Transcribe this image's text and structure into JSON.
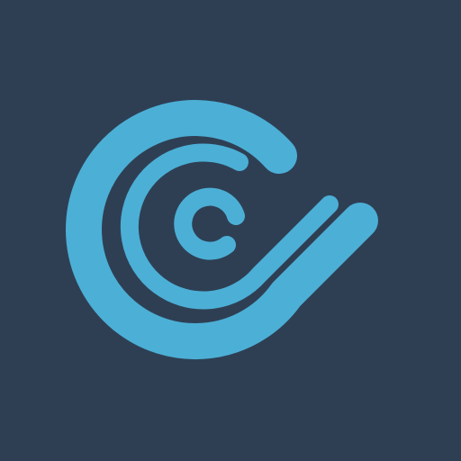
{
  "app_icon": {
    "icon": "circular-swirl-logo-icon",
    "colors": {
      "background": "#2e3f54",
      "mark": "#4cafd6"
    }
  }
}
